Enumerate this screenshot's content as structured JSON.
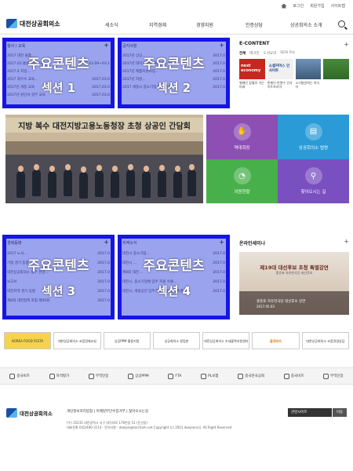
{
  "topbar": {
    "login": "로그인",
    "join": "회원가입",
    "sitemap": "사이트맵"
  },
  "header": {
    "logo": "대전상공회의소",
    "nav": [
      "세소식",
      "지역경제",
      "경영지원",
      "인증상담",
      "상공회의소 소개"
    ]
  },
  "panels": [
    {
      "heading": "행사 / 교육",
      "big1": "주요콘텐츠",
      "big2": "섹션 1",
      "rows": [
        {
          "t": "2017 대전 물품...",
          "d": ""
        },
        {
          "t": "2017.03 통원 실무교육",
          "d": "2017.03.09~03.1"
        },
        {
          "t": "2017.4 지방...",
          "d": ""
        },
        {
          "t": "2017 최우수 교육...",
          "d": "2017.03.0"
        },
        {
          "t": "2017년 개정 교육",
          "d": "2017.03.0"
        },
        {
          "t": "2017년 원인서 실무 교육",
          "d": "2017.03.0"
        }
      ]
    },
    {
      "heading": "공지사항",
      "big1": "주요콘텐츠",
      "big2": "섹션 2",
      "rows": [
        {
          "t": "2017년 상공...",
          "d": "2017.0"
        },
        {
          "t": "2017년 대덕구 주최 2017년 상공...",
          "d": "2017.0"
        },
        {
          "t": "2017년 제품지원사업...",
          "d": "2017.0"
        },
        {
          "t": "2017년 지원...",
          "d": "2017.0"
        },
        {
          "t": "2017 세종시 중소기업 확대 추진",
          "d": "2017.0"
        }
      ]
    },
    {
      "heading": "경제동향",
      "big1": "주요콘텐츠",
      "big2": "섹션 3",
      "rows": [
        {
          "t": "2017 노사...",
          "d": "2017.0"
        },
        {
          "t": "기업 경기 동향",
          "d": "2017.0"
        },
        {
          "t": "대전상공회의소 실무 전망...",
          "d": "2017.0"
        },
        {
          "t": "보고서",
          "d": "2017.0"
        },
        {
          "t": "대전지역 경기 동향",
          "d": "2017.0"
        },
        {
          "t": "제6회 대전정책 포럼 제95회",
          "d": "2017.0"
        }
      ]
    },
    {
      "heading": "지역소식",
      "big1": "주요콘텐츠",
      "big2": "섹션 4",
      "rows": [
        {
          "t": "대전시 중소기업...",
          "d": "2017.0"
        },
        {
          "t": "대전시 ...",
          "d": "2017.0"
        },
        {
          "t": "제9회 대전 ...",
          "d": "2017.0"
        },
        {
          "t": "대전시, 중소기업체 입주 지원 수출...",
          "d": "2017.0"
        },
        {
          "t": "대전시, 개성공단 입주기업 우수상품 특별",
          "d": "2017.0"
        }
      ]
    }
  ],
  "econtent": {
    "title": "E-CONTENT",
    "tabs": [
      "전체",
      "메거진",
      "도서요약",
      "SERI Pro"
    ],
    "thumbs": [
      {
        "label": "next economy",
        "caption": "벌떼인 잡월이 가는 미래"
      },
      {
        "label": "소셜커머스 인사이트",
        "caption": "론제인 한열수 인사이트프리아"
      },
      {
        "label": "",
        "caption": "소식통권하는 미디어"
      }
    ]
  },
  "banner": {
    "title": "지방 복수 대전지방고용노동청장 초청 상공인 간담회"
  },
  "tiles": [
    {
      "label": "역대회장",
      "color": "#8d4fb4"
    },
    {
      "label": "상공회의소 법령",
      "color": "#2a9bd6"
    },
    {
      "label": "의원현황",
      "color": "#48b04a"
    },
    {
      "label": "찾아오시는 길",
      "color": "#7a4fbf"
    }
  ],
  "seminar": {
    "title": "온라인세미나",
    "line1": "제19대 대선후보 초청 특별강연",
    "line2": "홍준표 자유한국당 대선후보",
    "line3": "홍준표 자유한국당 대선후보 강연",
    "line4": "2017.05.03"
  },
  "partners": [
    "KOREA FOOD FESTA",
    "대한상공회의소 코참경제교실",
    "상공PPM 활용지원",
    "상공회의소 알림판",
    "대전상공회의소 조세불복지원센터",
    "올댓비즈",
    "대한상공회의소 코참경영상담"
  ],
  "services": [
    "중국비즈",
    "자격평가",
    "무역인증",
    "상공PPM",
    "FTA",
    "PL보험",
    "중국한국상회",
    "중국비즈",
    "무역인증"
  ],
  "footer": {
    "logo": "대전상공회의소",
    "links": "개인정보처리방침 | 이메일무단수집거부 | 찾아오시는길",
    "addr1": "(우) 35235 대전광역시 서구 대덕대로 176번길 51 (둔산동)",
    "addr2": "대표전화 042)480-3114 · 문의사항 : daejon@korcham.net Copyright (c) 2001 daejeoncci, All Right Reserved",
    "select": "관련사이트",
    "go": "이동"
  }
}
